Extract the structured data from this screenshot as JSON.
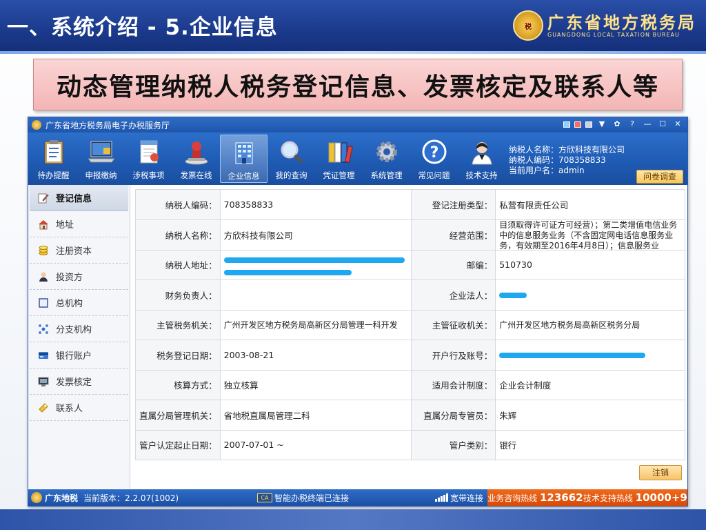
{
  "slide": {
    "title": "一、系统介绍 - 5.企业信息",
    "bureau_cn": "广东省地方税务局",
    "bureau_en": "GUANGDONG LOCAL TAXATION BUREAU",
    "banner": "动态管理纳税人税务登记信息、发票核定及联系人等"
  },
  "window": {
    "title": "广东省地方税务局电子办税服务厅"
  },
  "toolbar": {
    "tools": [
      {
        "label": "待办提醒",
        "icon": "clipboard-icon"
      },
      {
        "label": "申报缴纳",
        "icon": "laptop-icon"
      },
      {
        "label": "涉税事项",
        "icon": "document-icon"
      },
      {
        "label": "发票在线",
        "icon": "stamp-icon"
      },
      {
        "label": "企业信息",
        "icon": "building-icon"
      },
      {
        "label": "我的查询",
        "icon": "magnifier-icon"
      },
      {
        "label": "凭证管理",
        "icon": "binders-icon"
      },
      {
        "label": "系统管理",
        "icon": "gear-icon"
      },
      {
        "label": "常见问题",
        "icon": "question-icon"
      },
      {
        "label": "技术支持",
        "icon": "support-agent-icon"
      }
    ],
    "user_name": "纳税人名称：方欣科技有限公司",
    "user_code": "纳税人编码：708358833",
    "current_user": "当前用户名：admin",
    "survey": "问卷调查"
  },
  "sidebar": {
    "items": [
      {
        "label": "登记信息",
        "icon": "edit-icon"
      },
      {
        "label": "地址",
        "icon": "house-icon"
      },
      {
        "label": "注册资本",
        "icon": "coins-icon"
      },
      {
        "label": "投资方",
        "icon": "person-icon"
      },
      {
        "label": "总机构",
        "icon": "frame-icon"
      },
      {
        "label": "分支机构",
        "icon": "branch-icon"
      },
      {
        "label": "银行账户",
        "icon": "bank-card-icon"
      },
      {
        "label": "发票核定",
        "icon": "monitor-icon"
      },
      {
        "label": "联系人",
        "icon": "contact-icon"
      }
    ]
  },
  "info": {
    "rows": [
      {
        "l1": "纳税人编码：",
        "v1": "708358833",
        "l2": "登记注册类型：",
        "v2": "私营有限责任公司"
      },
      {
        "l1": "纳税人名称：",
        "v1": "方欣科技有限公司",
        "l2": "经营范围：",
        "v2": "目须取得许可证方可经营）；第二类增值电信业务中的信息服务业务（不含固定网电话信息服务业务，有效期至2016年4月8日）；信息服务业"
      },
      {
        "l1": "纳税人地址：",
        "v1": "",
        "l2": "邮编：",
        "v2": "510730"
      },
      {
        "l1": "财务负责人：",
        "v1": "",
        "l2": "企业法人：",
        "v2": ""
      },
      {
        "l1": "主管税务机关：",
        "v1": "广州开发区地方税务局高新区分局管理一科开发",
        "l2": "主管征收机关：",
        "v2": "广州开发区地方税务局高新区税务分局"
      },
      {
        "l1": "税务登记日期：",
        "v1": "2003-08-21",
        "l2": "开户行及账号：",
        "v2": ""
      },
      {
        "l1": "核算方式：",
        "v1": "独立核算",
        "l2": "适用会计制度：",
        "v2": "企业会计制度"
      },
      {
        "l1": "直属分局管理机关：",
        "v1": "省地税直属局管理二科",
        "l2": "直属分局专管员：",
        "v2": "朱辉"
      },
      {
        "l1": "管户认定起止日期：",
        "v1": "2007-07-01 ~",
        "l2": "管户类别：",
        "v2": "银行"
      }
    ],
    "cancel": "注销"
  },
  "statusbar": {
    "brand": "广东地税",
    "version": "当前版本：2.2.07(1002)",
    "terminal": "智能办税终端已连接",
    "network": "宽带连接",
    "hotline_label": "业务咨询热线",
    "hotline": "123662",
    "support_label": "技术支持热线",
    "support": "10000+9"
  },
  "colors": {
    "header_blue": "#1b3a8c",
    "toolbar_blue": "#1f5bb4",
    "banner_pink": "#f4b5b5",
    "hotline_orange": "#e85a10",
    "redaction": "#1fa8f0"
  }
}
